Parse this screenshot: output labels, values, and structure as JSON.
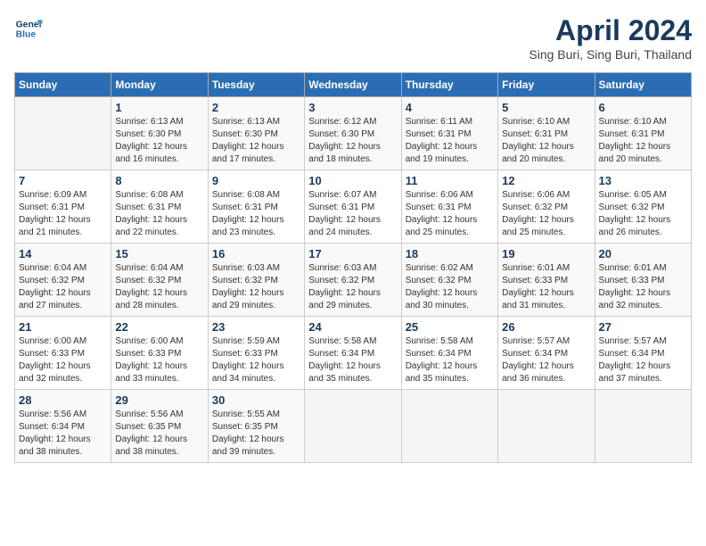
{
  "logo": {
    "line1": "General",
    "line2": "Blue"
  },
  "title": "April 2024",
  "subtitle": "Sing Buri, Sing Buri, Thailand",
  "headers": [
    "Sunday",
    "Monday",
    "Tuesday",
    "Wednesday",
    "Thursday",
    "Friday",
    "Saturday"
  ],
  "weeks": [
    [
      {
        "day": "",
        "info": ""
      },
      {
        "day": "1",
        "info": "Sunrise: 6:13 AM\nSunset: 6:30 PM\nDaylight: 12 hours\nand 16 minutes."
      },
      {
        "day": "2",
        "info": "Sunrise: 6:13 AM\nSunset: 6:30 PM\nDaylight: 12 hours\nand 17 minutes."
      },
      {
        "day": "3",
        "info": "Sunrise: 6:12 AM\nSunset: 6:30 PM\nDaylight: 12 hours\nand 18 minutes."
      },
      {
        "day": "4",
        "info": "Sunrise: 6:11 AM\nSunset: 6:31 PM\nDaylight: 12 hours\nand 19 minutes."
      },
      {
        "day": "5",
        "info": "Sunrise: 6:10 AM\nSunset: 6:31 PM\nDaylight: 12 hours\nand 20 minutes."
      },
      {
        "day": "6",
        "info": "Sunrise: 6:10 AM\nSunset: 6:31 PM\nDaylight: 12 hours\nand 20 minutes."
      }
    ],
    [
      {
        "day": "7",
        "info": "Sunrise: 6:09 AM\nSunset: 6:31 PM\nDaylight: 12 hours\nand 21 minutes."
      },
      {
        "day": "8",
        "info": "Sunrise: 6:08 AM\nSunset: 6:31 PM\nDaylight: 12 hours\nand 22 minutes."
      },
      {
        "day": "9",
        "info": "Sunrise: 6:08 AM\nSunset: 6:31 PM\nDaylight: 12 hours\nand 23 minutes."
      },
      {
        "day": "10",
        "info": "Sunrise: 6:07 AM\nSunset: 6:31 PM\nDaylight: 12 hours\nand 24 minutes."
      },
      {
        "day": "11",
        "info": "Sunrise: 6:06 AM\nSunset: 6:31 PM\nDaylight: 12 hours\nand 25 minutes."
      },
      {
        "day": "12",
        "info": "Sunrise: 6:06 AM\nSunset: 6:32 PM\nDaylight: 12 hours\nand 25 minutes."
      },
      {
        "day": "13",
        "info": "Sunrise: 6:05 AM\nSunset: 6:32 PM\nDaylight: 12 hours\nand 26 minutes."
      }
    ],
    [
      {
        "day": "14",
        "info": "Sunrise: 6:04 AM\nSunset: 6:32 PM\nDaylight: 12 hours\nand 27 minutes."
      },
      {
        "day": "15",
        "info": "Sunrise: 6:04 AM\nSunset: 6:32 PM\nDaylight: 12 hours\nand 28 minutes."
      },
      {
        "day": "16",
        "info": "Sunrise: 6:03 AM\nSunset: 6:32 PM\nDaylight: 12 hours\nand 29 minutes."
      },
      {
        "day": "17",
        "info": "Sunrise: 6:03 AM\nSunset: 6:32 PM\nDaylight: 12 hours\nand 29 minutes."
      },
      {
        "day": "18",
        "info": "Sunrise: 6:02 AM\nSunset: 6:32 PM\nDaylight: 12 hours\nand 30 minutes."
      },
      {
        "day": "19",
        "info": "Sunrise: 6:01 AM\nSunset: 6:33 PM\nDaylight: 12 hours\nand 31 minutes."
      },
      {
        "day": "20",
        "info": "Sunrise: 6:01 AM\nSunset: 6:33 PM\nDaylight: 12 hours\nand 32 minutes."
      }
    ],
    [
      {
        "day": "21",
        "info": "Sunrise: 6:00 AM\nSunset: 6:33 PM\nDaylight: 12 hours\nand 32 minutes."
      },
      {
        "day": "22",
        "info": "Sunrise: 6:00 AM\nSunset: 6:33 PM\nDaylight: 12 hours\nand 33 minutes."
      },
      {
        "day": "23",
        "info": "Sunrise: 5:59 AM\nSunset: 6:33 PM\nDaylight: 12 hours\nand 34 minutes."
      },
      {
        "day": "24",
        "info": "Sunrise: 5:58 AM\nSunset: 6:34 PM\nDaylight: 12 hours\nand 35 minutes."
      },
      {
        "day": "25",
        "info": "Sunrise: 5:58 AM\nSunset: 6:34 PM\nDaylight: 12 hours\nand 35 minutes."
      },
      {
        "day": "26",
        "info": "Sunrise: 5:57 AM\nSunset: 6:34 PM\nDaylight: 12 hours\nand 36 minutes."
      },
      {
        "day": "27",
        "info": "Sunrise: 5:57 AM\nSunset: 6:34 PM\nDaylight: 12 hours\nand 37 minutes."
      }
    ],
    [
      {
        "day": "28",
        "info": "Sunrise: 5:56 AM\nSunset: 6:34 PM\nDaylight: 12 hours\nand 38 minutes."
      },
      {
        "day": "29",
        "info": "Sunrise: 5:56 AM\nSunset: 6:35 PM\nDaylight: 12 hours\nand 38 minutes."
      },
      {
        "day": "30",
        "info": "Sunrise: 5:55 AM\nSunset: 6:35 PM\nDaylight: 12 hours\nand 39 minutes."
      },
      {
        "day": "",
        "info": ""
      },
      {
        "day": "",
        "info": ""
      },
      {
        "day": "",
        "info": ""
      },
      {
        "day": "",
        "info": ""
      }
    ]
  ]
}
